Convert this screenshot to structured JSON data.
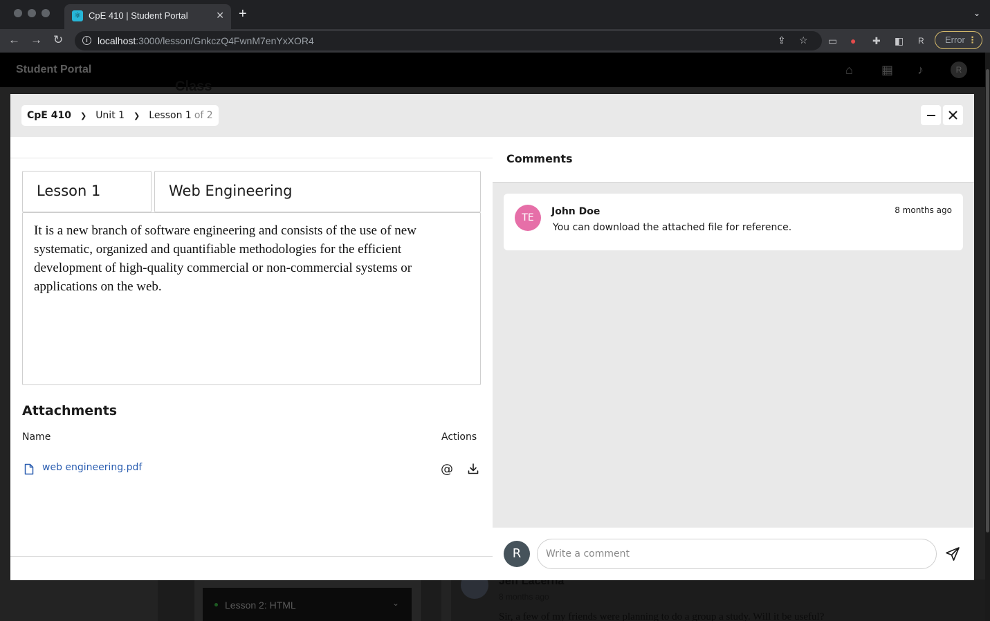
{
  "browser": {
    "tab_title": "CpE 410 | Student Portal",
    "url_host": "localhost",
    "url_path": ":3000/lesson/GnkczQ4FwnM7enYxXOR4",
    "profile_initial": "R",
    "error_label": "Error",
    "icons": [
      "back-icon",
      "forward-icon",
      "reload-icon",
      "share-icon",
      "bookmark-star-icon",
      "extensions-icon",
      "side-panel-icon"
    ]
  },
  "app": {
    "title": "Student Portal",
    "avatar_initial": "R",
    "nav_icons": [
      "home-icon",
      "calendar-icon",
      "bell-icon"
    ],
    "background": {
      "heading": "Class",
      "lesson_row": "Lesson 2: HTML",
      "comment_author": "Jeff Lacerna",
      "comment_time": "8 months ago",
      "comment_text": "Sir, a few of my friends were planning to do a group a study. Will it be useful?"
    }
  },
  "modal": {
    "breadcrumb": {
      "course": "CpE 410",
      "unit": "Unit 1",
      "lesson": "Lesson 1",
      "position": "of 2"
    },
    "lesson": {
      "label": "Lesson 1",
      "title": "Web Engineering",
      "description": "It is a new branch of software engineering and consists of the use of new systematic, organized and quantifiable methodologies for the efficient development of high-quality commercial or non-commercial systems or applications on the web."
    },
    "attachments": {
      "title": "Attachments",
      "col_name": "Name",
      "col_actions": "Actions",
      "files": [
        {
          "name": "web engineering.pdf"
        }
      ]
    },
    "comments": {
      "title": "Comments",
      "items": [
        {
          "initials": "TE",
          "author": "John Doe",
          "time": "8 months ago",
          "text": "You can download the attached file for reference.",
          "avatar_color": "#e66fa8"
        }
      ],
      "composer": {
        "avatar_initial": "R",
        "placeholder": "Write a comment"
      }
    }
  }
}
